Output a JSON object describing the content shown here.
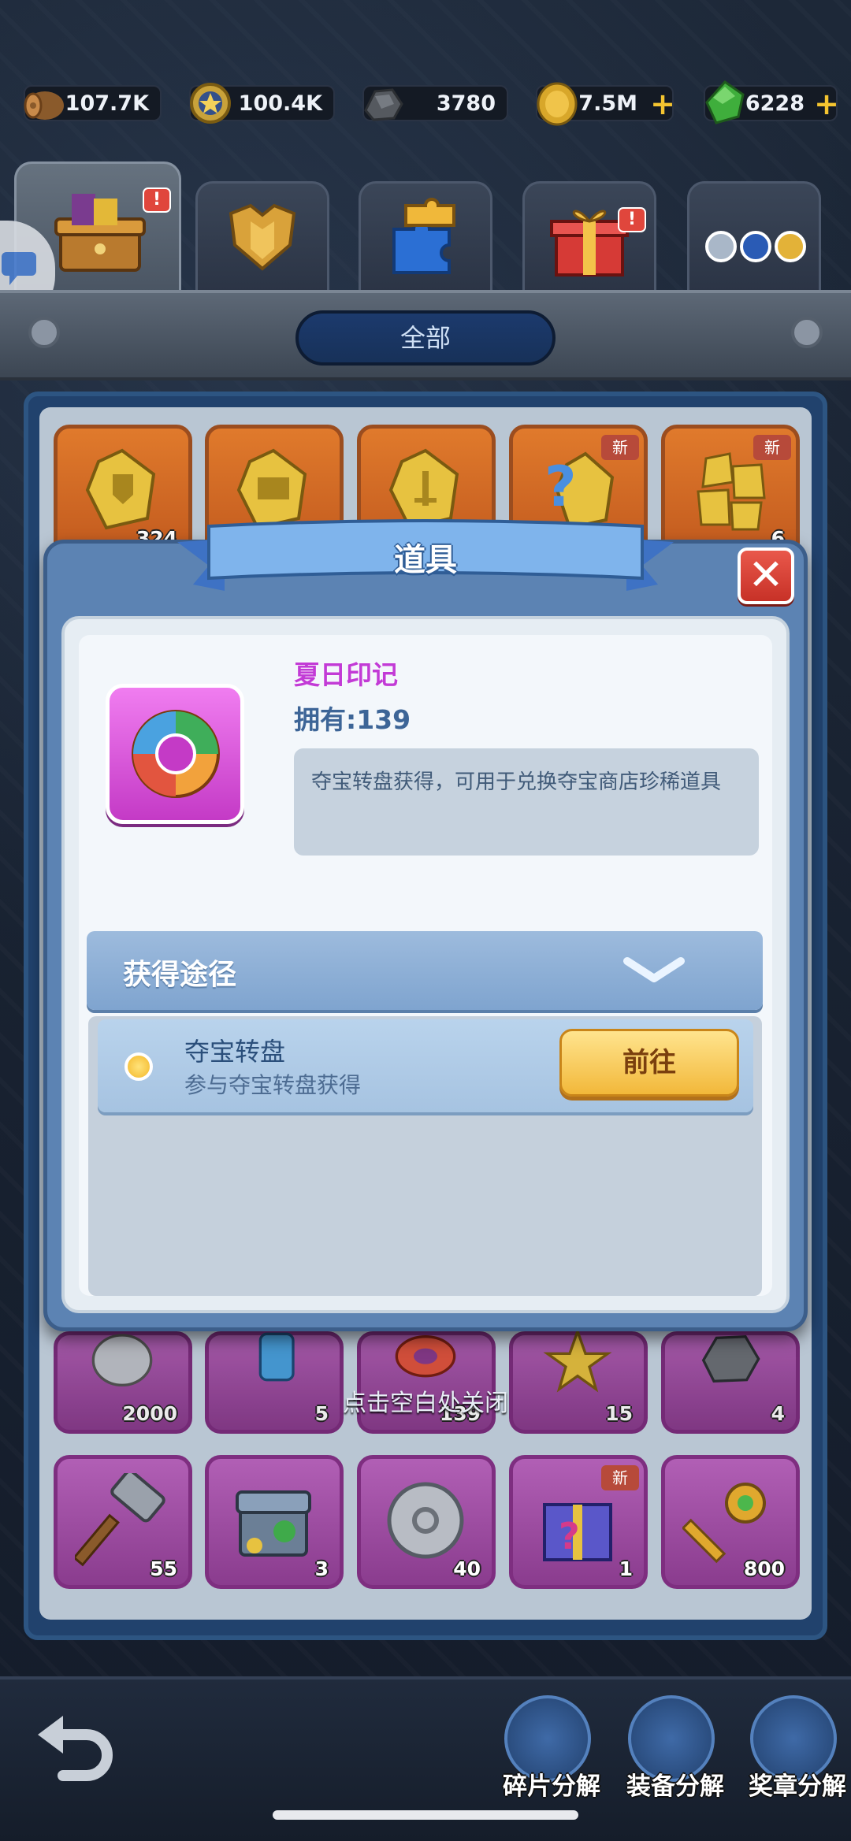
{
  "resources": [
    {
      "name": "wood",
      "value": "107.7K",
      "icon": "log-icon"
    },
    {
      "name": "medal",
      "value": "100.4K",
      "icon": "star-medal-icon"
    },
    {
      "name": "ore",
      "value": "3780",
      "icon": "iron-ore-icon"
    },
    {
      "name": "gold",
      "value": "7.5M",
      "icon": "gold-coin-icon",
      "plus": "+"
    },
    {
      "name": "gem",
      "value": "6228",
      "icon": "green-gem-icon",
      "plus": "+"
    }
  ],
  "tabs": [
    {
      "name": "chest",
      "icon": "treasure-chest-icon",
      "badge": "!"
    },
    {
      "name": "armor",
      "icon": "armor-icon"
    },
    {
      "name": "puzzle",
      "icon": "puzzle-piece-icon"
    },
    {
      "name": "gift",
      "icon": "gift-box-icon",
      "badge": "!"
    },
    {
      "name": "gems",
      "icon": "gem-orbs-icon"
    }
  ],
  "filter": {
    "label": "全部"
  },
  "inventory": {
    "row1": [
      {
        "count": "324",
        "icon": "shield-crystal-icon",
        "new": ""
      },
      {
        "count": "",
        "icon": "book-crystal-icon",
        "new": ""
      },
      {
        "count": "",
        "icon": "sword-crystal-icon",
        "new": ""
      },
      {
        "count": "",
        "icon": "question-crystal-icon",
        "new": "新"
      },
      {
        "count": "6",
        "icon": "crystal-bundle-icon",
        "new": "新"
      }
    ],
    "row2": [
      {
        "count": "2000",
        "icon": "silver-coin-icon"
      },
      {
        "count": "5",
        "icon": "blue-scroll-icon"
      },
      {
        "count": "139",
        "icon": "swim-ring-icon"
      },
      {
        "count": "15",
        "icon": "gold-star-icon"
      },
      {
        "count": "4",
        "icon": "stone-icon"
      }
    ],
    "row3": [
      {
        "count": "55",
        "icon": "hammer-icon",
        "new": ""
      },
      {
        "count": "3",
        "icon": "treasure-box-icon",
        "new": ""
      },
      {
        "count": "40",
        "icon": "silver-gear-coin-icon",
        "new": ""
      },
      {
        "count": "1",
        "icon": "mystery-gift-icon",
        "new": "新"
      },
      {
        "count": "800",
        "icon": "clover-key-icon",
        "new": ""
      }
    ]
  },
  "hint": "点击空白处关闭",
  "modal": {
    "title": "道具",
    "close": "✕",
    "item_name": "夏日印记",
    "owned": "拥有:139",
    "description": "夺宝转盘获得，可用于兑换夺宝商店珍稀道具",
    "source_header": "获得途径",
    "route": {
      "name": "夺宝转盘",
      "desc": "参与夺宝转盘获得",
      "button": "前往"
    }
  },
  "bottom": {
    "buttons": [
      "碎片分解",
      "装备分解",
      "奖章分解"
    ]
  },
  "colors": {
    "modal_blue": "#5c83b3",
    "rare_purple": "#b15fb5",
    "legend_orange": "#e07a2c",
    "go_button": "#f2b83a"
  }
}
